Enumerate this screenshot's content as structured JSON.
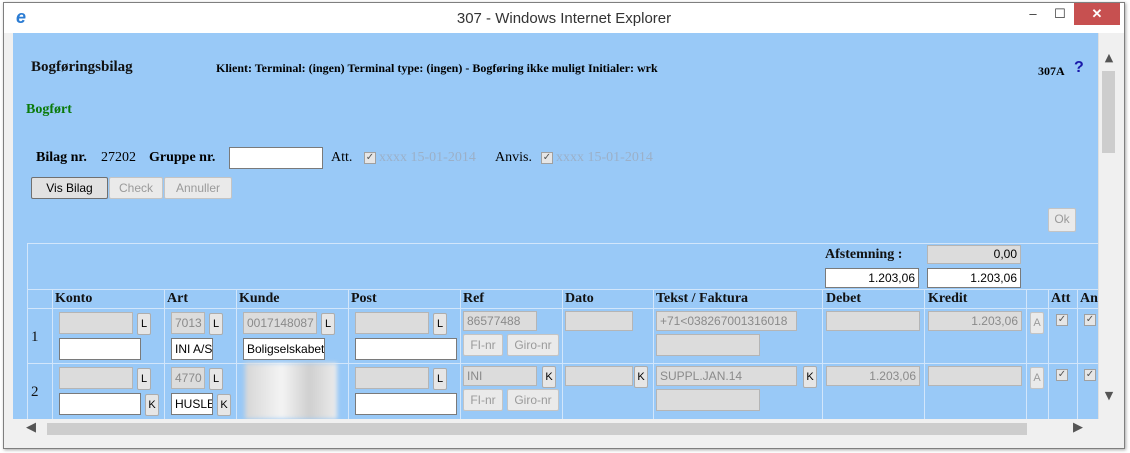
{
  "window": {
    "title": "307 - Windows Internet Explorer"
  },
  "header": {
    "title": "Bogføringsbilag",
    "info": "Klient: Terminal: (ingen) Terminal type: (ingen) - Bogføring ikke muligt Initialer: wrk",
    "code": "307A",
    "help": "?"
  },
  "status": "Bogført",
  "bilag": {
    "nr_label": "Bilag nr.",
    "nr_value": "27202",
    "gruppe_label": "Gruppe nr.",
    "gruppe_value": "",
    "att_label": "Att.",
    "att_value": "xxxx 15-01-2014",
    "anvis_label": "Anvis.",
    "anvis_value": "xxxx 15-01-2014"
  },
  "buttons": {
    "vis_bilag": "Vis Bilag",
    "check": "Check",
    "annuller": "Annuller",
    "ok": "Ok"
  },
  "afstemning": {
    "label": "Afstemning :",
    "diff": "0,00",
    "debet_total": "1.203,06",
    "kredit_total": "1.203,06"
  },
  "columns": [
    "Konto",
    "Art",
    "Kunde",
    "Post",
    "Ref",
    "Dato",
    "Tekst / Faktura",
    "Debet",
    "Kredit",
    "Att",
    "An"
  ],
  "rows": [
    {
      "num": "1",
      "art_code": "7013",
      "art_text": "INI A/S",
      "kunde_code": "0017148087",
      "kunde_text": "Boligselskabet",
      "ref": "86577488",
      "ref_btn1": "FI-nr",
      "ref_btn2": "Giro-nr",
      "tekst": "+71<038267001316018",
      "debet": "",
      "kredit": "1.203,06"
    },
    {
      "num": "2",
      "art_code": "4770",
      "art_text": "HUSLEJE",
      "ref": "INI",
      "ref_btn1": "FI-nr",
      "ref_btn2": "Giro-nr",
      "tekst": "SUPPL.JAN.14",
      "debet": "1.203,06",
      "kredit": ""
    }
  ],
  "mini": {
    "L": "L",
    "K": "K",
    "A": "A"
  }
}
